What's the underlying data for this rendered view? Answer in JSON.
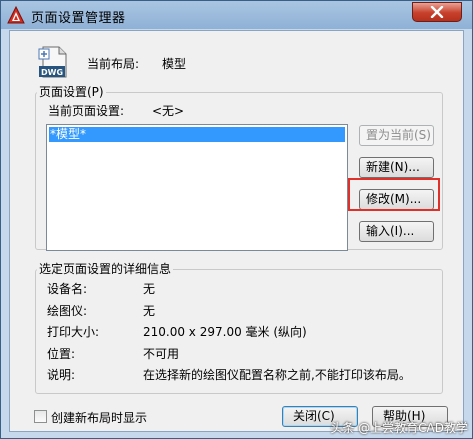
{
  "window": {
    "title": "页面设置管理器"
  },
  "current_layout": {
    "label": "当前布局:",
    "value": "模型"
  },
  "page_setup": {
    "group_title": "页面设置(P)",
    "current_label": "当前页面设置:",
    "current_value": "<无>",
    "list_items": [
      "*模型*"
    ],
    "buttons": {
      "set_current": "置为当前(S)",
      "new": "新建(N)...",
      "modify": "修改(M)...",
      "import": "输入(I)..."
    }
  },
  "details": {
    "group_title": "选定页面设置的详细信息",
    "rows": [
      {
        "label": "设备名:",
        "value": "无"
      },
      {
        "label": "绘图仪:",
        "value": "无"
      },
      {
        "label": "打印大小:",
        "value": "210.00 x 297.00 毫米 (纵向)"
      },
      {
        "label": "位置:",
        "value": "不可用"
      },
      {
        "label": "说明:",
        "value": "在选择新的绘图仪配置名称之前,不能打印该布局。"
      }
    ]
  },
  "footer": {
    "checkbox_label": "创建新布局时显示",
    "checkbox_checked": false,
    "close_button": "关闭(C)",
    "help_button": "帮助(H)"
  },
  "watermark": "头条 @上尝教育CAD教学",
  "colors": {
    "selection": "#3399ff",
    "highlight_box": "#e0302a",
    "close_button": "#c7402b"
  },
  "icons": [
    "autocad-app-icon",
    "close-icon",
    "dwg-file-icon"
  ]
}
